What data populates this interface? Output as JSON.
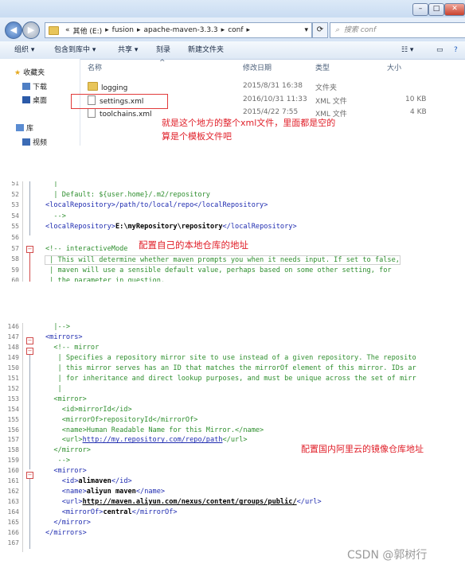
{
  "explorer": {
    "window_buttons": [
      "–",
      "□",
      "✕"
    ],
    "breadcrumb": [
      "«",
      "其他 (E:)",
      "fusion",
      "apache-maven-3.3.3",
      "conf"
    ],
    "search_placeholder": "搜索 conf",
    "toolbar": [
      "组织 ▾",
      "包含到库中 ▾",
      "共享 ▾",
      "刻录",
      "新建文件夹"
    ],
    "sidebar": [
      "收藏夹",
      "下载",
      "桌面",
      "库",
      "视频"
    ],
    "columns": [
      "名称",
      "修改日期",
      "类型",
      "大小"
    ],
    "files": [
      {
        "name": "logging",
        "date": "2015/8/31 16:38",
        "type": "文件夹",
        "size": ""
      },
      {
        "name": "settings.xml",
        "date": "2016/10/31 11:33",
        "type": "XML 文件",
        "size": "10 KB"
      },
      {
        "name": "toolchains.xml",
        "date": "2015/4/22 7:55",
        "type": "XML 文件",
        "size": "4 KB"
      }
    ],
    "annotation_lines": [
      "就是这个地方的整个xml文件，里面都是空的",
      "算是个模板文件吧"
    ]
  },
  "panel1": {
    "lines": [
      {
        "n": "51",
        "t": "  |"
      },
      {
        "n": "52",
        "t": "  | Default: ${user.home}/.m2/repository"
      },
      {
        "n": "53",
        "t": "<localRepository>/path/to/local/repo</localRepository>"
      },
      {
        "n": "54",
        "t": "  -->"
      },
      {
        "n": "55",
        "a": "<localRepository>",
        "b": "E:\\myRepository\\repository",
        "c": "</localRepository>"
      },
      {
        "n": "56",
        "t": ""
      },
      {
        "n": "57",
        "t": "<!-- interactiveMode"
      },
      {
        "n": "58",
        "t": " | This will determine whether maven prompts you when it needs input. If set to false,"
      },
      {
        "n": "59",
        "t": " | maven will use a sensible default value, perhaps based on some other setting, for"
      },
      {
        "n": "60",
        "t": " | the parameter in question."
      }
    ],
    "annotation": "配置自己的本地仓库的地址"
  },
  "panel2": {
    "lines": [
      {
        "n": "146",
        "t": "  |-->",
        "c": "green"
      },
      {
        "n": "147",
        "t": "<mirrors>",
        "c": "blue"
      },
      {
        "n": "148",
        "t": "  <!-- mirror",
        "c": "green"
      },
      {
        "n": "149",
        "t": "   | Specifies a repository mirror site to use instead of a given repository. The reposito",
        "c": "green"
      },
      {
        "n": "150",
        "t": "   | this mirror serves has an ID that matches the mirrorOf element of this mirror. IDs ar",
        "c": "green"
      },
      {
        "n": "151",
        "t": "   | for inheritance and direct lookup purposes, and must be unique across the set of mirr",
        "c": "green"
      },
      {
        "n": "152",
        "t": "   |",
        "c": "green"
      },
      {
        "n": "153",
        "t": "  <mirror>",
        "c": "green"
      },
      {
        "n": "154",
        "t": "    <id>mirrorId</id>",
        "c": "green"
      },
      {
        "n": "155",
        "t": "    <mirrorOf>repositoryId</mirrorOf>",
        "c": "green"
      },
      {
        "n": "156",
        "t": "    <name>Human Readable Name for this Mirror.</name>",
        "c": "green"
      },
      {
        "n": "157",
        "a": "    <url>",
        "b": "http://my.repository.com/repo/path",
        "c2": "</url>",
        "c": "green-link"
      },
      {
        "n": "158",
        "t": "  </mirror>",
        "c": "green"
      },
      {
        "n": "159",
        "t": "   -->",
        "c": "green"
      },
      {
        "n": "160",
        "t": "  <mirror>",
        "c": "blue"
      },
      {
        "n": "161",
        "a": "    <id>",
        "b": "alimaven",
        "c2": "</id>",
        "c": "mixed"
      },
      {
        "n": "162",
        "a": "    <name>",
        "b": "aliyun maven",
        "c2": "</name>",
        "c": "mixed"
      },
      {
        "n": "163",
        "a": "    <url>",
        "b": "http://maven.aliyun.com/nexus/content/groups/public/",
        "c2": "</url>",
        "c": "mixed-link"
      },
      {
        "n": "164",
        "a": "    <mirrorOf>",
        "b": "central",
        "c2": "</mirrorOf>",
        "c": "mixed"
      },
      {
        "n": "165",
        "t": "  </mirror>",
        "c": "blue"
      },
      {
        "n": "166",
        "t": "</mirrors>",
        "c": "blue"
      },
      {
        "n": "167",
        "t": "",
        "c": "blue"
      }
    ],
    "annotation": "配置国内阿里云的镜像仓库地址"
  },
  "watermark": "CSDN @郭树行"
}
